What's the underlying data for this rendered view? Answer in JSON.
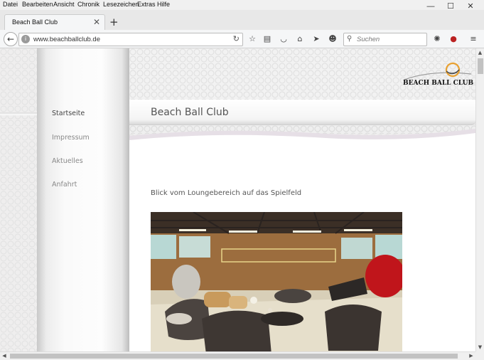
{
  "menubar": {
    "items": [
      "Datei",
      "Bearbeiten",
      "Ansicht",
      "Chronik",
      "Lesezeichen",
      "Extras",
      "Hilfe"
    ]
  },
  "window": {
    "minimize": "—",
    "maximize": "☐",
    "close": "✕"
  },
  "tab": {
    "title": "Beach Ball Club",
    "close": "✕",
    "new_tab": "+"
  },
  "navbar": {
    "back": "←",
    "url": "www.beachballclub.de",
    "reload": "↻",
    "search_placeholder": "Suchen",
    "icons": [
      "star-icon",
      "reading-list-icon",
      "pocket-icon",
      "home-icon",
      "send-icon",
      "smiley-icon",
      "settings-icon",
      "shield-icon",
      "menu-icon"
    ]
  },
  "site": {
    "logo_text": "BEACH BALL CLUB",
    "page_title": "Beach Ball Club",
    "nav": [
      {
        "label": "Startseite",
        "active": true
      },
      {
        "label": "Impressum",
        "active": false
      },
      {
        "label": "Aktuelles",
        "active": false
      },
      {
        "label": "Anfahrt",
        "active": false
      }
    ],
    "caption": "Blick vom Loungebereich auf das Spielfeld"
  },
  "colors": {
    "accent_orange": "#e8a030",
    "nav_text": "#888888",
    "title_text": "#555555"
  }
}
